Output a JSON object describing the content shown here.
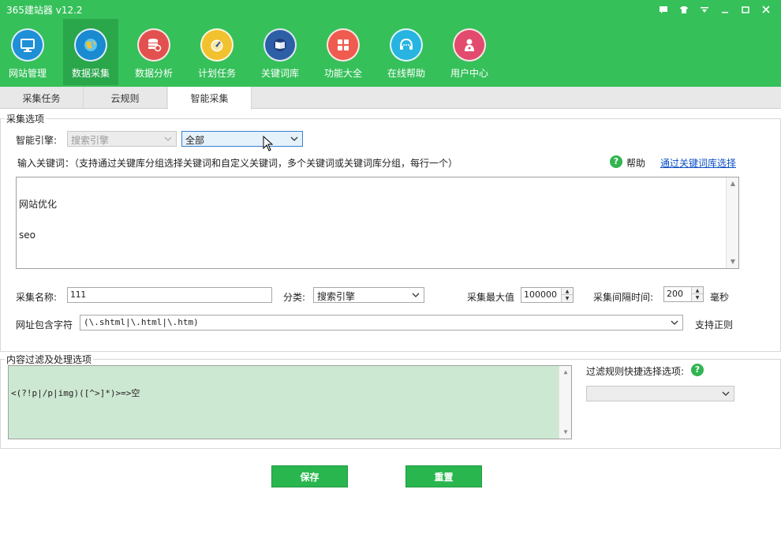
{
  "app": {
    "title": "365建站器 v12.2"
  },
  "window_controls": [
    "chat-icon",
    "skin-icon",
    "menu-icon",
    "minimize-icon",
    "maximize-icon",
    "close-icon"
  ],
  "nav": {
    "items": [
      {
        "label": "网站管理",
        "icon": "monitor-icon",
        "color": "#1f8fd6"
      },
      {
        "label": "数据采集",
        "icon": "globe-icon",
        "color": "#1a8ad1",
        "active": true
      },
      {
        "label": "数据分析",
        "icon": "database-icon",
        "color": "#e2514f"
      },
      {
        "label": "计划任务",
        "icon": "gauge-icon",
        "color": "#f2c12e"
      },
      {
        "label": "关键词库",
        "icon": "book-icon",
        "color": "#2d5fa6"
      },
      {
        "label": "功能大全",
        "icon": "grid-icon",
        "color": "#ef5b4f"
      },
      {
        "label": "在线帮助",
        "icon": "headset-icon",
        "color": "#27b4e0"
      },
      {
        "label": "用户中心",
        "icon": "user-icon",
        "color": "#e24b6d"
      }
    ]
  },
  "tabs": [
    {
      "label": "采集任务"
    },
    {
      "label": "云规则"
    },
    {
      "label": "智能采集",
      "active": true
    }
  ],
  "collect": {
    "legend": "采集选项",
    "engine_label": "智能引擎:",
    "engine_value": "搜索引擎",
    "engine_scope": "全部",
    "keywords_label": "输入关键词：（支持通过关键库分组选择关键词和自定义关键词，多个关键词或关键词库分组，每行一个）",
    "help_label": "帮助",
    "keyword_lib_link": "通过关键词库选择",
    "keywords": [
      "网站优化",
      "seo"
    ],
    "name_label": "采集名称:",
    "name_value": "111",
    "category_label": "分类:",
    "category_value": "搜索引擎",
    "max_label": "采集最大值",
    "max_value": "100000",
    "interval_label": "采集间隔时间:",
    "interval_value": "200",
    "interval_unit": "毫秒",
    "url_label": "网址包含字符",
    "url_value": "(\\.shtml|\\.html|\\.htm)",
    "regex_label": "支持正则"
  },
  "filter": {
    "legend": "内容过滤及处理选项",
    "rule_text": "<(?!p|/p|img)([^>]*)>=>空",
    "quick_label": "过滤规则快捷选择选项:",
    "quick_value": ""
  },
  "actions": {
    "save": "保存",
    "reset": "重置"
  }
}
